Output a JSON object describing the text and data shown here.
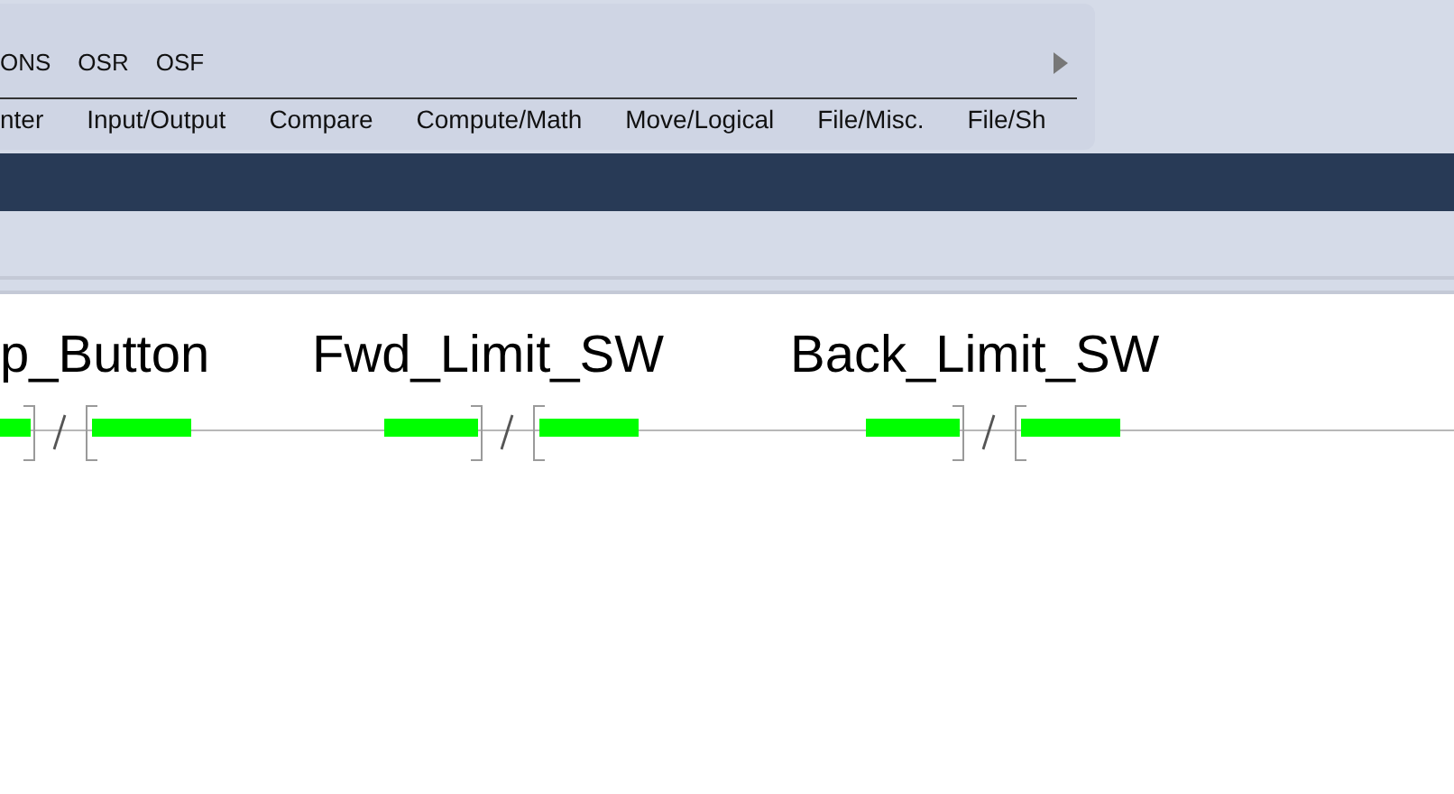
{
  "toolbar": {
    "instructions": [
      "ONS",
      "OSR",
      "OSF"
    ],
    "tabs": [
      {
        "label": "nter",
        "selected": false
      },
      {
        "label": "Input/Output",
        "selected": false
      },
      {
        "label": "Compare",
        "selected": false
      },
      {
        "label": "Compute/Math",
        "selected": false
      },
      {
        "label": "Move/Logical",
        "selected": false
      },
      {
        "label": "File/Misc.",
        "selected": false
      },
      {
        "label": "File/Sh",
        "selected": false
      }
    ]
  },
  "rung": {
    "contacts": [
      {
        "tag": "p_Button",
        "kind": "xio",
        "powered_in": true,
        "powered_out": true
      },
      {
        "tag": "Fwd_Limit_SW",
        "kind": "xio",
        "powered_in": true,
        "powered_out": true
      },
      {
        "tag": "Back_Limit_SW",
        "kind": "xio",
        "powered_in": true,
        "powered_out": true
      }
    ]
  }
}
